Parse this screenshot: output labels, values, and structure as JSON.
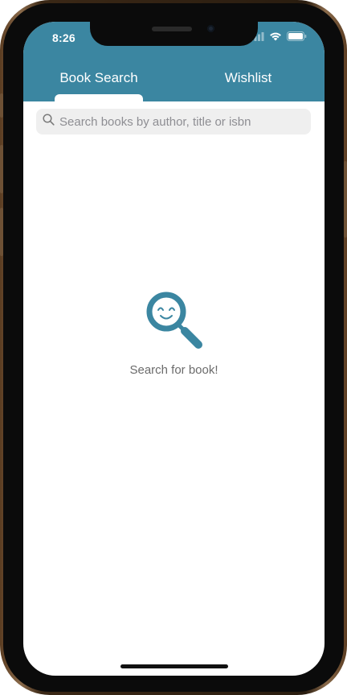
{
  "status_bar": {
    "time": "8:26",
    "icons": [
      "cellular-icon",
      "wifi-icon",
      "battery-icon"
    ]
  },
  "tabs": [
    {
      "label": "Book Search",
      "selected": true
    },
    {
      "label": "Wishlist",
      "selected": false
    }
  ],
  "search": {
    "placeholder": "Search books by author, title or isbn",
    "value": ""
  },
  "empty_state": {
    "message": "Search for book!",
    "icon": "magnifier-smile-icon"
  },
  "colors": {
    "header": "#3b86a1",
    "accent": "#3b86a1"
  }
}
